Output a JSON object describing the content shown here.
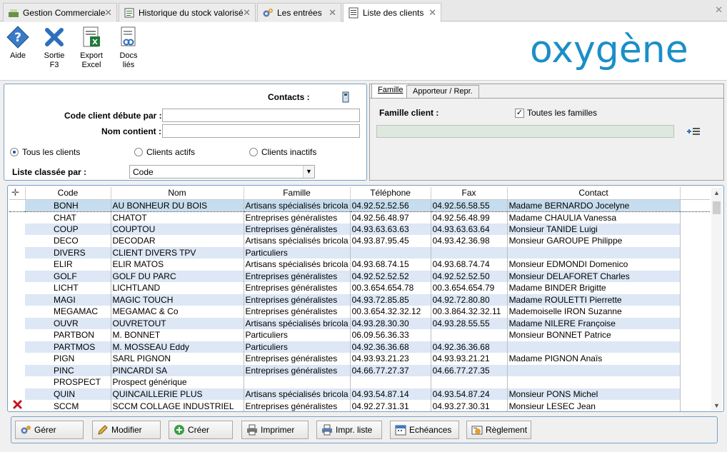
{
  "tabs": [
    {
      "label": "Gestion Commerciale",
      "icon": "cash-register-icon",
      "active": false
    },
    {
      "label": "Historique du stock valorisé",
      "icon": "history-doc-icon",
      "active": false
    },
    {
      "label": "Les entrées",
      "icon": "gears-icon",
      "active": false
    },
    {
      "label": "Liste des clients",
      "icon": "list-doc-icon",
      "active": true
    }
  ],
  "toolbar": {
    "aide_label": "Aide",
    "sortie_label": "Sortie F3",
    "export_label": "Export Excel",
    "docs_label": "Docs liés"
  },
  "logo_text": "oxygène",
  "filters": {
    "contacts_label": "Contacts :",
    "code_label": "Code client débute par :",
    "code_value": "",
    "nom_label": "Nom contient :",
    "nom_value": "",
    "radio_all": "Tous les clients",
    "radio_active": "Clients actifs",
    "radio_inactive": "Clients inactifs",
    "sort_label": "Liste classée par :",
    "sort_value": "Code"
  },
  "right_panel": {
    "tab_famille": "Famille",
    "tab_apporteur": "Apporteur / Repr.",
    "famille_label": "Famille client :",
    "toutes_label": "Toutes les familles",
    "toutes_checked": true
  },
  "grid": {
    "columns": [
      "Code",
      "Nom",
      "Famille",
      "Téléphone",
      "Fax",
      "Contact"
    ],
    "rows": [
      [
        "BONH",
        "AU BONHEUR DU BOIS",
        "Artisans spécialisés bricola",
        "04.92.52.52.56",
        "04.92.56.58.55",
        "Madame BERNARDO Jocelyne"
      ],
      [
        "CHAT",
        "CHATOT",
        "Entreprises généralistes",
        "04.92.56.48.97",
        "04.92.56.48.99",
        "Madame CHAULIA Vanessa"
      ],
      [
        "COUP",
        "COUPTOU",
        "Entreprises généralistes",
        "04.93.63.63.63",
        "04.93.63.63.64",
        "Monsieur TANIDE Luigi"
      ],
      [
        "DECO",
        "DECODAR",
        "Artisans spécialisés bricola",
        "04.93.87.95.45",
        "04.93.42.36.98",
        "Monsieur GAROUPE Philippe"
      ],
      [
        "DIVERS",
        "CLIENT DIVERS TPV",
        "Particuliers",
        "",
        "",
        ""
      ],
      [
        "ELIR",
        "ELIR MATOS",
        "Artisans spécialisés bricola",
        "04.93.68.74.15",
        "04.93.68.74.74",
        "Monsieur EDMONDI Domenico"
      ],
      [
        "GOLF",
        "GOLF DU PARC",
        "Entreprises généralistes",
        "04.92.52.52.52",
        "04.92.52.52.50",
        "Monsieur DELAFORET Charles"
      ],
      [
        "LICHT",
        "LICHTLAND",
        "Entreprises généralistes",
        "00.3.654.654.78",
        "00.3.654.654.79",
        "Madame BINDER Brigitte"
      ],
      [
        "MAGI",
        "MAGIC TOUCH",
        "Entreprises généralistes",
        "04.93.72.85.85",
        "04.92.72.80.80",
        "Madame ROULETTI Pierrette"
      ],
      [
        "MEGAMAC",
        "MEGAMAC & Co",
        "Entreprises généralistes",
        "00.3.654.32.32.12",
        "00.3.864.32.32.11",
        "Mademoiselle IRON Suzanne"
      ],
      [
        "OUVR",
        "OUVRETOUT",
        "Artisans spécialisés bricola",
        "04.93.28.30.30",
        "04.93.28.55.55",
        "Madame NILERE Françoise"
      ],
      [
        "PARTBON",
        "M. BONNET",
        "Particuliers",
        "06.09.56.36.33",
        "",
        "Monsieur BONNET Patrice"
      ],
      [
        "PARTMOS",
        "M. MOSSEAU Eddy",
        "Particuliers",
        "04.92.36.36.68",
        "04.92.36.36.68",
        ""
      ],
      [
        "PIGN",
        "SARL PIGNON",
        "Entreprises généralistes",
        "04.93.93.21.23",
        "04.93.93.21.21",
        "Madame PIGNON Anaïs"
      ],
      [
        "PINC",
        "PINCARDI SA",
        "Entreprises généralistes",
        "04.66.77.27.37",
        "04.66.77.27.35",
        ""
      ],
      [
        "PROSPECT",
        "Prospect générique",
        "",
        "",
        "",
        ""
      ],
      [
        "QUIN",
        "QUINCAILLERIE PLUS",
        "Artisans spécialisés bricola",
        "04.93.54.87.14",
        "04.93.54.87.24",
        "Monsieur PONS Michel"
      ],
      [
        "SCCM",
        "SCCM COLLAGE INDUSTRIEL",
        "Entreprises généralistes",
        "04.92.27.31.31",
        "04.93.27.30.31",
        "Monsieur LESEC Jean"
      ]
    ],
    "selected_row": 0,
    "inactive_row": 17
  },
  "buttons": {
    "gerer": "Gérer",
    "modifier": "Modifier",
    "creer": "Créer",
    "imprimer": "Imprimer",
    "impr_liste": "Impr. liste",
    "echeances": "Echéances",
    "reglement": "Règlement"
  },
  "colors": {
    "accent": "#1a8fc8",
    "selected_row": "#c5ddee",
    "alt_row": "#dde7f5"
  }
}
